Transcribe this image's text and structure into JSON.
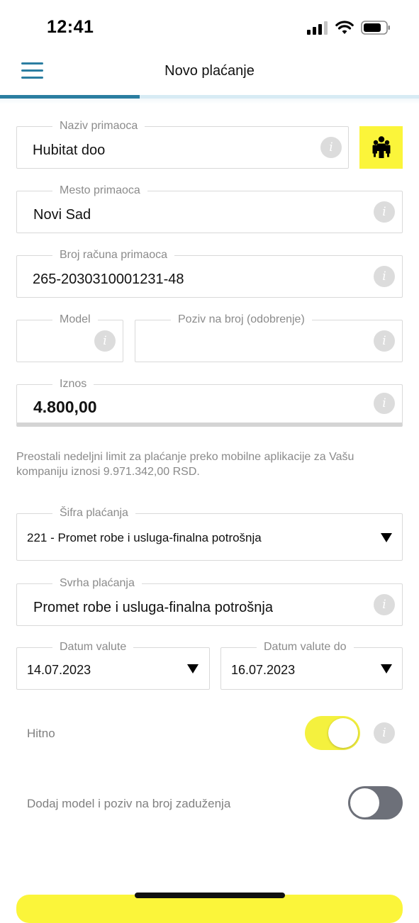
{
  "status_bar": {
    "time": "12:41"
  },
  "header": {
    "title": "Novo plaćanje",
    "progress_fraction": 0.333
  },
  "form": {
    "recipient_name": {
      "label": "Naziv primaoca",
      "value": "Hubitat doo"
    },
    "recipient_city": {
      "label": "Mesto primaoca",
      "value": "Novi Sad"
    },
    "recipient_account": {
      "label": "Broj računa primaoca",
      "value": "265-2030310001231-48"
    },
    "model": {
      "label": "Model",
      "value": ""
    },
    "reference": {
      "label": "Poziv na broj (odobrenje)",
      "value": ""
    },
    "amount": {
      "label": "Iznos",
      "value": "4.800,00"
    },
    "limit_note": "Preostali nedeljni limit za plaćanje preko mobilne aplikacije za Vašu kompaniju iznosi 9.971.342,00 RSD.",
    "payment_code": {
      "label": "Šifra plaćanja",
      "value": "221 - Promet robe i usluga-finalna potrošnja"
    },
    "payment_purpose": {
      "label": "Svrha plaćanja",
      "value": "Promet robe i usluga-finalna potrošnja"
    },
    "value_date": {
      "label": "Datum valute",
      "value": "14.07.2023"
    },
    "value_date_to": {
      "label": "Datum valute do",
      "value": "16.07.2023"
    },
    "urgent": {
      "label": "Hitno",
      "enabled": true
    },
    "debit_model": {
      "label": "Dodaj model i poziv na broj zaduženja",
      "enabled": false
    }
  },
  "icons": {
    "menu": "hamburger-menu-icon",
    "contacts": "contacts-group-icon",
    "info": "info-icon",
    "dropdown": "triangle-down-icon",
    "info_glyph": "i"
  },
  "colors": {
    "accent_blue": "#2b7ea1",
    "accent_yellow": "#fbf53a",
    "toggle_off": "#6d7079"
  }
}
